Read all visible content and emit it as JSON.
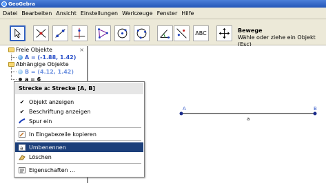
{
  "window": {
    "title": "GeoGebra"
  },
  "menu": [
    "Datei",
    "Bearbeiten",
    "Ansicht",
    "Einstellungen",
    "Werkzeuge",
    "Fenster",
    "Hilfe"
  ],
  "toolbar": {
    "tools": [
      "move-tool",
      "point-tool",
      "line-tool",
      "perpendicular-line-tool",
      "polygon-tool",
      "circle-tool",
      "conic-tool",
      "angle-tool",
      "reflect-tool",
      "text-tool",
      "move-graphics-view-tool"
    ],
    "text_tool_label": "ABC",
    "selected_tool_name": "Bewege",
    "selected_tool_help": "Wähle oder ziehe ein Objekt (Esc)"
  },
  "algebra_view": {
    "close_label": "×",
    "free_folder": "Freie Objekte",
    "free_objects": [
      "A = (-1.88, 1.42)"
    ],
    "dependent_folder": "Abhängige Objekte",
    "dependent_objects": [
      "B = (4.12, 1.42)",
      "a = 6"
    ]
  },
  "graphics_view": {
    "point_a_label": "A",
    "point_b_label": "B",
    "segment_label": "a",
    "colors": {
      "point": "#1a2b8c",
      "label": "#3358c8",
      "segment": "#000000"
    }
  },
  "context_menu": {
    "title": "Strecke a: Strecke [A, B]",
    "items": [
      {
        "label": "Objekt anzeigen",
        "checked": true
      },
      {
        "label": "Beschriftung anzeigen",
        "checked": true
      },
      {
        "label": "Spur ein",
        "checked": false
      },
      {
        "label": "In Eingabezeile kopieren"
      },
      {
        "label": "Umbenennen",
        "highlighted": true
      },
      {
        "label": "Löschen"
      },
      {
        "label": "Eigenschaften ..."
      }
    ],
    "highlight_color": "#1c3f7a"
  }
}
